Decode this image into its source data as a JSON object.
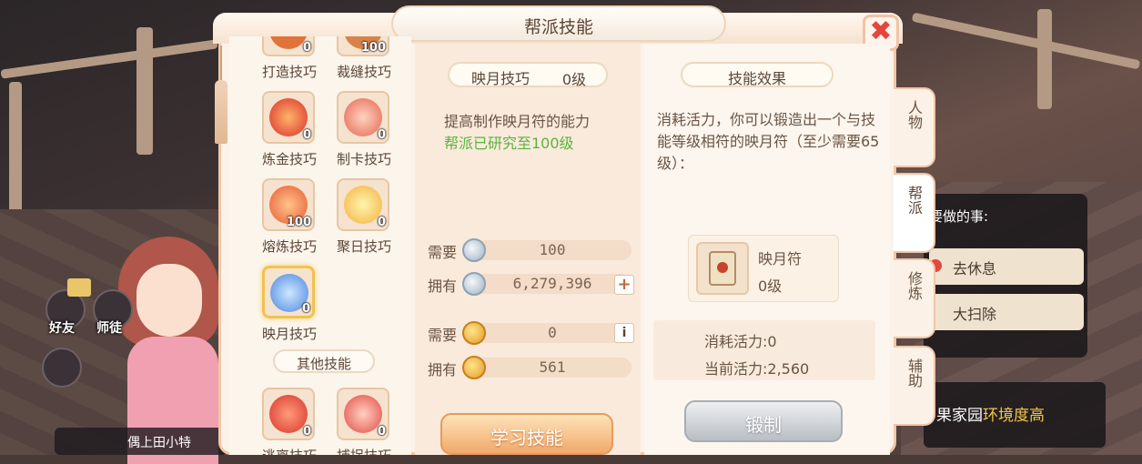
{
  "window": {
    "title": "帮派技能",
    "close_label": "✖"
  },
  "skills": [
    {
      "name": "打造技巧",
      "count": "0",
      "color": "#e0733a"
    },
    {
      "name": "裁缝技巧",
      "count": "100",
      "color": "#d9824a"
    },
    {
      "name": "炼金技巧",
      "count": "0",
      "color": "#d8302a"
    },
    {
      "name": "制卡技巧",
      "count": "0",
      "color": "#e46450"
    },
    {
      "name": "熔炼技巧",
      "count": "100",
      "color": "#e85a36"
    },
    {
      "name": "聚日技巧",
      "count": "0",
      "color": "#f3b13c"
    },
    {
      "name": "映月技巧",
      "count": "0",
      "color": "#4a86e0"
    }
  ],
  "other_skills_label": "其他技能",
  "other_skills": [
    {
      "name": "逃离技巧",
      "count": "0",
      "color": "#d8352c"
    },
    {
      "name": "捕捉技巧",
      "count": "0",
      "color": "#e24a44"
    }
  ],
  "detail": {
    "skill_name": "映月技巧",
    "skill_level": "0级",
    "description": "提高制作映月符的能力",
    "research_status": "帮派已研究至100级",
    "need_label": "需要",
    "have_label": "拥有",
    "silver_need": "100",
    "silver_have": "6,279,396",
    "gold_need": "0",
    "gold_have": "561",
    "plus": "+",
    "info": "i",
    "learn_button": "学习技能"
  },
  "effect": {
    "title": "技能效果",
    "text": "消耗活力，你可以锻造出一个与技能等级相符的映月符（至少需要65级）：",
    "item_name": "映月符",
    "item_level": "0级",
    "vigor_cost": "消耗活力:0",
    "vigor_current": "当前活力:2,560",
    "forge_button": "锻制"
  },
  "tabs": [
    "人物",
    "帮派",
    "修炼",
    "辅助"
  ],
  "background": {
    "left_icons": [
      "好友",
      "师徒"
    ],
    "prompt_title": "要做的事:",
    "options": [
      "去休息",
      "大扫除"
    ],
    "banner_prefix": "果家园",
    "banner_highlight": "环境度高",
    "name_fragment": "偶上田小特"
  }
}
